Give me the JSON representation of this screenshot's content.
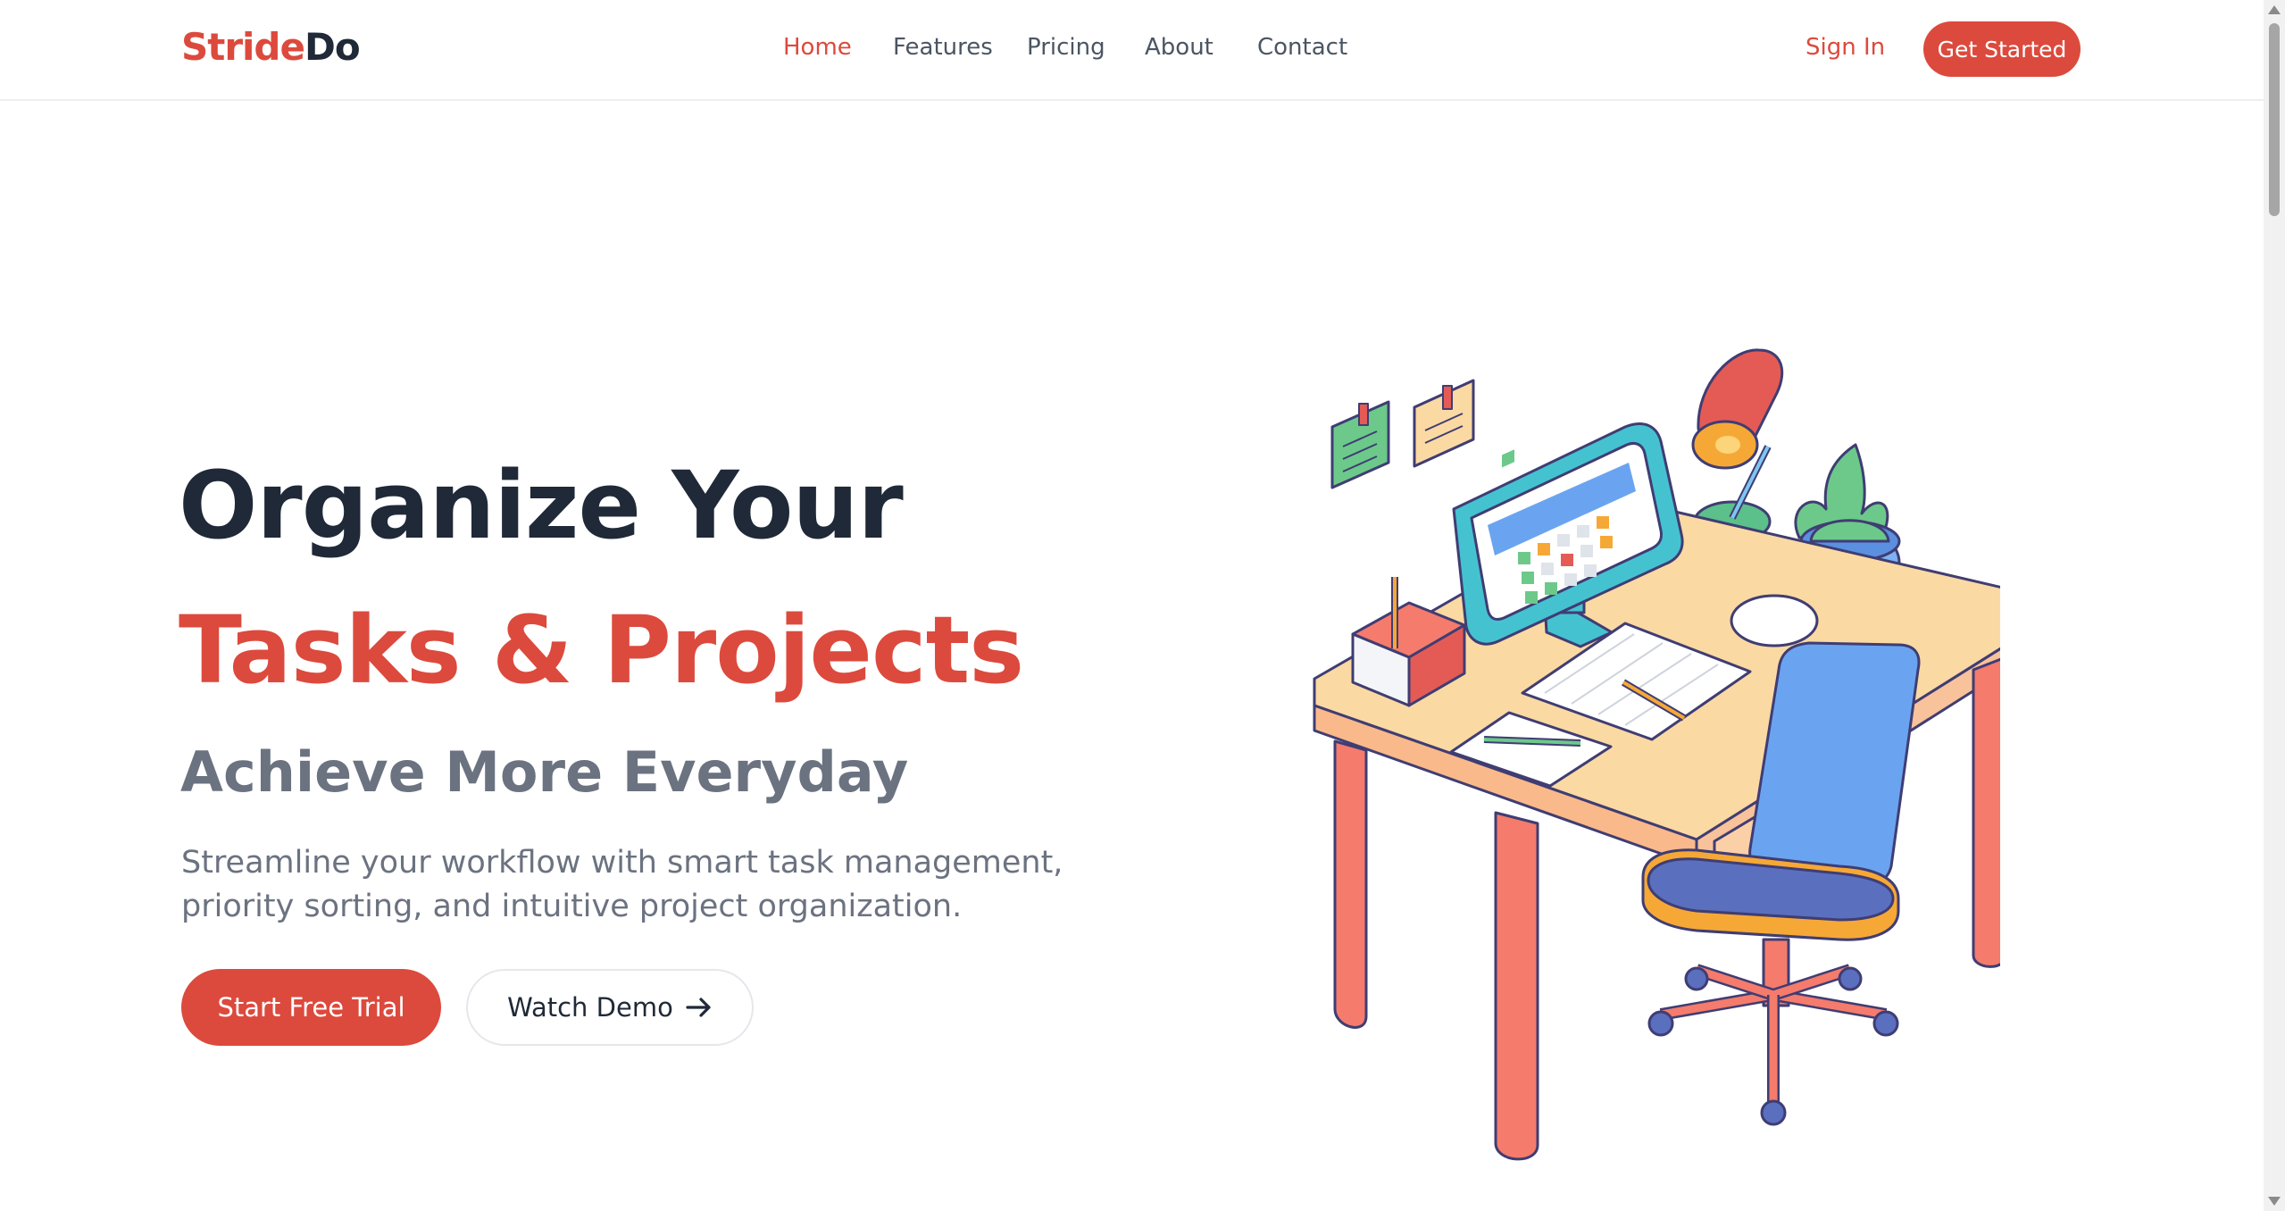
{
  "brand": {
    "part1": "Stride",
    "part2": "Do"
  },
  "nav": {
    "items": [
      {
        "label": "Home",
        "active": true
      },
      {
        "label": "Features",
        "active": false
      },
      {
        "label": "Pricing",
        "active": false
      },
      {
        "label": "About",
        "active": false
      },
      {
        "label": "Contact",
        "active": false
      }
    ],
    "sign_in": "Sign In",
    "get_started": "Get Started"
  },
  "hero": {
    "title_line1": "Organize Your",
    "title_line2": "Tasks & Projects",
    "subtitle": "Achieve More Everyday",
    "description": "Streamline your workflow with smart task management, priority sorting, and intuitive project organization.",
    "primary_cta": "Start Free Trial",
    "secondary_cta": "Watch Demo",
    "secondary_cta_icon": "arrow-right-icon"
  },
  "colors": {
    "accent": "#dc4a3d",
    "heading": "#1f2937",
    "muted": "#6b7280"
  }
}
